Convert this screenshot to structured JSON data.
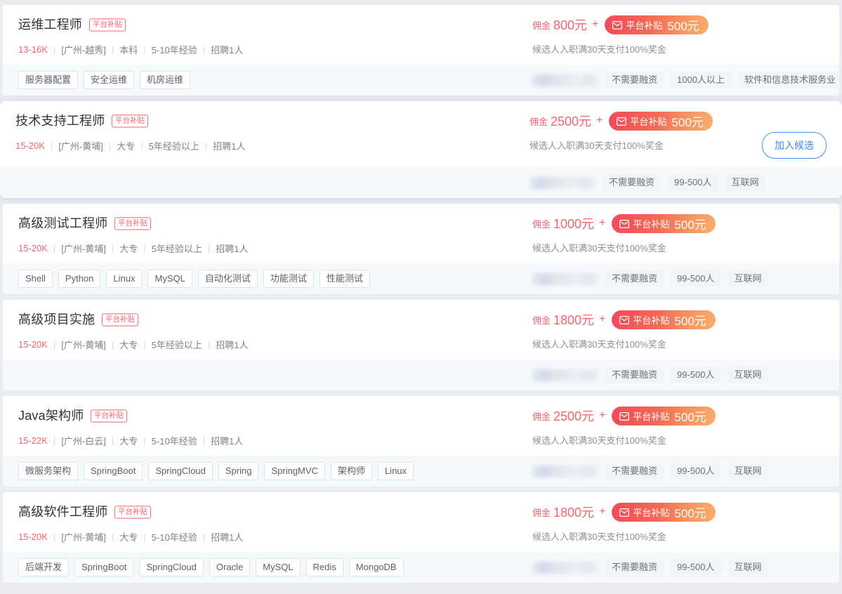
{
  "theme": {
    "page_background": "#eaecf2",
    "card_background": "#ffffff",
    "footer_background": "#f4f9fc",
    "accent_red": "#f5646e",
    "accent_blue": "#3d8bf5",
    "pill_gradient_from": "#f2495c",
    "pill_gradient_to": "#f8ad6d",
    "tag_background": "#f2f4f6"
  },
  "common": {
    "subsidy_badge": "平台补贴",
    "commission_label": "佣金",
    "plus": "+",
    "pill_label": "平台补贴",
    "payout_note": "候选人入职满30天支付100%奖金",
    "join_button": "加入候选",
    "envelope_icon": "envelope-icon",
    "company_name_redacted": ""
  },
  "jobs": [
    {
      "title": "运维工程师",
      "badge": "平台补贴",
      "salary": "13-16K",
      "location": "[广州-越秀]",
      "education": "本科",
      "experience": "5-10年经验",
      "headcount": "招聘1人",
      "commission_label": "佣金",
      "commission_amount": "800元",
      "subsidy_label": "平台补贴",
      "subsidy_amount": "500元",
      "payout_note": "候选人入职满30天支付100%奖金",
      "skills": [
        "服务器配置",
        "安全运维",
        "机房运维"
      ],
      "company_tags": [
        "不需要融资",
        "1000人以上",
        "软件和信息技术服务业"
      ],
      "hovered": false,
      "join_button": ""
    },
    {
      "title": "技术支持工程师",
      "badge": "平台补贴",
      "salary": "15-20K",
      "location": "[广州-黄埔]",
      "education": "大专",
      "experience": "5年经验以上",
      "headcount": "招聘1人",
      "commission_label": "佣金",
      "commission_amount": "2500元",
      "subsidy_label": "平台补贴",
      "subsidy_amount": "500元",
      "payout_note": "候选人入职满30天支付100%奖金",
      "skills": [],
      "company_tags": [
        "不需要融资",
        "99-500人",
        "互联网"
      ],
      "hovered": true,
      "join_button": "加入候选"
    },
    {
      "title": "高级测试工程师",
      "badge": "平台补贴",
      "salary": "15-20K",
      "location": "[广州-黄埔]",
      "education": "大专",
      "experience": "5年经验以上",
      "headcount": "招聘1人",
      "commission_label": "佣金",
      "commission_amount": "1000元",
      "subsidy_label": "平台补贴",
      "subsidy_amount": "500元",
      "payout_note": "候选人入职满30天支付100%奖金",
      "skills": [
        "Shell",
        "Python",
        "Linux",
        "MySQL",
        "自动化测试",
        "功能测试",
        "性能测试"
      ],
      "company_tags": [
        "不需要融资",
        "99-500人",
        "互联网"
      ],
      "hovered": false,
      "join_button": ""
    },
    {
      "title": "高级项目实施",
      "badge": "平台补贴",
      "salary": "15-20K",
      "location": "[广州-黄埔]",
      "education": "大专",
      "experience": "5年经验以上",
      "headcount": "招聘1人",
      "commission_label": "佣金",
      "commission_amount": "1800元",
      "subsidy_label": "平台补贴",
      "subsidy_amount": "500元",
      "payout_note": "候选人入职满30天支付100%奖金",
      "skills": [],
      "company_tags": [
        "不需要融资",
        "99-500人",
        "互联网"
      ],
      "hovered": false,
      "join_button": ""
    },
    {
      "title": "Java架构师",
      "badge": "平台补贴",
      "salary": "15-22K",
      "location": "[广州-白云]",
      "education": "大专",
      "experience": "5-10年经验",
      "headcount": "招聘1人",
      "commission_label": "佣金",
      "commission_amount": "2500元",
      "subsidy_label": "平台补贴",
      "subsidy_amount": "500元",
      "payout_note": "候选人入职满30天支付100%奖金",
      "skills": [
        "微服务架构",
        "SpringBoot",
        "SpringCloud",
        "Spring",
        "SpringMVC",
        "架构师",
        "Linux"
      ],
      "company_tags": [
        "不需要融资",
        "99-500人",
        "互联网"
      ],
      "hovered": false,
      "join_button": ""
    },
    {
      "title": "高级软件工程师",
      "badge": "平台补贴",
      "salary": "15-20K",
      "location": "[广州-黄埔]",
      "education": "大专",
      "experience": "5-10年经验",
      "headcount": "招聘1人",
      "commission_label": "佣金",
      "commission_amount": "1800元",
      "subsidy_label": "平台补贴",
      "subsidy_amount": "500元",
      "payout_note": "候选人入职满30天支付100%奖金",
      "skills": [
        "后端开发",
        "SpringBoot",
        "SpringCloud",
        "Oracle",
        "MySQL",
        "Redis",
        "MongoDB"
      ],
      "company_tags": [
        "不需要融资",
        "99-500人",
        "互联网"
      ],
      "hovered": false,
      "join_button": ""
    }
  ]
}
